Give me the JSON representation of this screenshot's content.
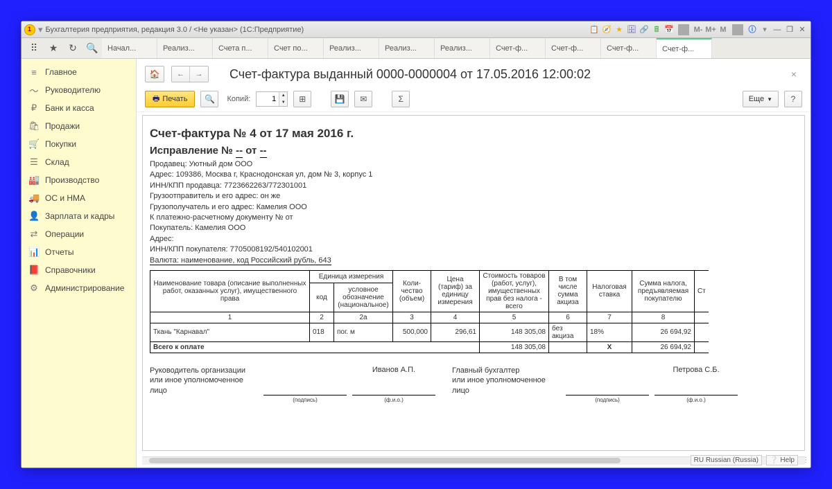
{
  "window_title": "Бухгалтерия предприятия, редакция 3.0 / <Не указан>  (1С:Предприятие)",
  "tabs": [
    "Начал...",
    "Реализ...",
    "Счета п...",
    "Счет по...",
    "Реализ...",
    "Реализ...",
    "Реализ...",
    "Счет-ф...",
    "Счет-ф...",
    "Счет-ф...",
    "Счет-ф..."
  ],
  "active_tab_index": 10,
  "sidebar": [
    {
      "icon": "≡",
      "label": "Главное"
    },
    {
      "icon": "〜",
      "label": "Руководителю"
    },
    {
      "icon": "₽",
      "label": "Банк и касса"
    },
    {
      "icon": "🛍",
      "label": "Продажи"
    },
    {
      "icon": "🛒",
      "label": "Покупки"
    },
    {
      "icon": "☰",
      "label": "Склад"
    },
    {
      "icon": "🏭",
      "label": "Производство"
    },
    {
      "icon": "🚚",
      "label": "ОС и НМА"
    },
    {
      "icon": "👤",
      "label": "Зарплата и кадры"
    },
    {
      "icon": "⇄",
      "label": "Операции"
    },
    {
      "icon": "📊",
      "label": "Отчеты"
    },
    {
      "icon": "📕",
      "label": "Справочники"
    },
    {
      "icon": "⚙",
      "label": "Администрирование"
    }
  ],
  "page_title": "Счет-фактура выданный 0000-0000004 от 17.05.2016 12:00:02",
  "toolbar": {
    "print": "Печать",
    "copies_label": "Копий:",
    "copies_value": "1",
    "more": "Еще",
    "help": "?"
  },
  "doc": {
    "title": "Счет-фактура № 4 от 17 мая 2016 г.",
    "subtitle_prefix": "Исправление № ",
    "subtitle_dash1": "--",
    "subtitle_from": " от ",
    "subtitle_dash2": "--",
    "seller": "Продавец: Уютный дом ООО",
    "address": "Адрес: 109386, Москва г, Краснодонская ул, дом № 3, корпус 1",
    "inn_seller": "ИНН/КПП продавца: 7723662263/772301001",
    "shipper": "Грузоотправитель и его адрес: он же",
    "consignee": "Грузополучатель и его адрес: Камелия ООО",
    "paydoc": "К платежно-расчетному документу №     от",
    "buyer": "Покупатель: Камелия ООО",
    "buyer_addr": "Адрес:",
    "inn_buyer": "ИНН/КПП покупателя: 7705008192/540102001",
    "currency": "Валюта: наименование, код Российский рубль, 643"
  },
  "table": {
    "headers": {
      "name": "Наименование товара (описание выполненных работ, оказанных услуг), имущественного права",
      "unit": "Единица измерения",
      "unit_code": "код",
      "unit_desc": "условное обозначение (национальное)",
      "qty": "Коли-\nчество\n(объем)",
      "price": "Цена (тариф) за единицу измерения",
      "cost": "Стоимость товаров (работ, услуг), имущественных прав без налога - всего",
      "excise": "В том числе сумма акциза",
      "rate": "Налоговая ставка",
      "tax": "Сумма налога, предъявляемая покупателю",
      "cost_with_cut": "Ст"
    },
    "numrow": [
      "1",
      "2",
      "2а",
      "3",
      "4",
      "5",
      "6",
      "7",
      "8"
    ],
    "row": {
      "name": "Ткань \"Карнавал\"",
      "code": "018",
      "unit": "пог. м",
      "qty": "500,000",
      "price": "296,61",
      "cost": "148 305,08",
      "excise": "без акциза",
      "rate": "18%",
      "tax": "26 694,92"
    },
    "total_label": "Всего к оплате",
    "total_cost": "148 305,08",
    "total_x": "X",
    "total_tax": "26 694,92"
  },
  "signs": {
    "head_label": "Руководитель организации\nили иное уполномоченное лицо",
    "head_name": "Иванов А.П.",
    "acc_label": "Главный бухгалтер\nили иное уполномоченное лицо",
    "acc_name": "Петрова С.Б.",
    "sign_under": "(подпись)",
    "fio_under": "(ф.и.о.)"
  },
  "status": {
    "lang": "RU Russian (Russia)",
    "help": "Help"
  }
}
